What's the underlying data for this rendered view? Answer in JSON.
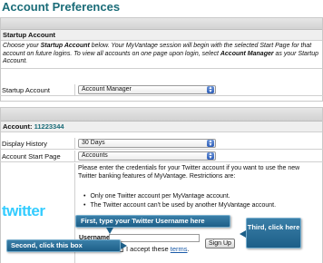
{
  "page": {
    "title": "Account Preferences"
  },
  "startup": {
    "section_label": "Startup Account",
    "intro_part1": "Choose your ",
    "intro_bold": "Startup Account",
    "intro_part2": " below. Your MyVantage session will begin with the selected Start Page for that account on future logins. To view all accounts on one page upon login, select ",
    "intro_bold2": "Account Manager",
    "intro_part3": " as your Startup Account.",
    "row_label": "Startup Account",
    "selected_value": "Account Manager"
  },
  "account": {
    "label_prefix": "Account: ",
    "number": "11223344",
    "display_history_label": "Display History",
    "display_history_value": "30 Days",
    "start_page_label": "Account Start Page",
    "start_page_value": "Accounts"
  },
  "twitter": {
    "logo_text": "twitter",
    "instructions": "Please enter the credentials for your Twitter account if you want to use the new Twitter banking features of MyVantage. Restrictions are:",
    "restrictions": [
      "Only one Twitter account per MyVantage account.",
      "The Twitter account can't be used by another MyVantage account."
    ],
    "username_label": "Username:",
    "accept_text": "I accept these ",
    "terms_link": "terms",
    "terms_suffix": ".",
    "signup_label": "Sign Up"
  },
  "callouts": {
    "first": "First, type your Twitter Username here",
    "second": "Second, click this box",
    "third": "Third, click here"
  }
}
